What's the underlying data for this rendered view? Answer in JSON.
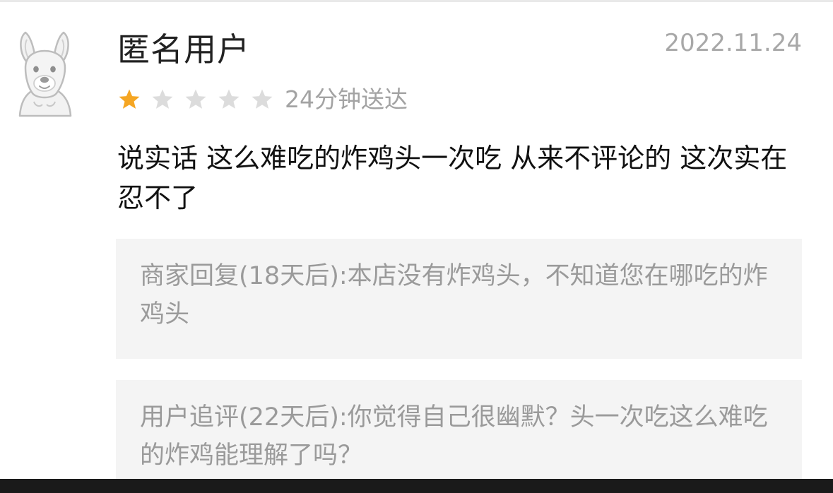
{
  "review": {
    "username": "匿名用户",
    "date": "2022.11.24",
    "rating": 1,
    "max_rating": 5,
    "star_color_active": "#f5a623",
    "star_color_inactive": "#dcdcdc",
    "delivery_time": "24分钟送达",
    "text": "说实话 这么难吃的炸鸡头一次吃 从来不评论的 这次实在忍不了"
  },
  "merchant_reply": {
    "text": "商家回复(18天后):本店没有炸鸡头，不知道您在哪吃的炸鸡头"
  },
  "followup": {
    "text": "用户追评(22天后):你觉得自己很幽默？头一次吃这么难吃的炸鸡能理解了吗？"
  }
}
